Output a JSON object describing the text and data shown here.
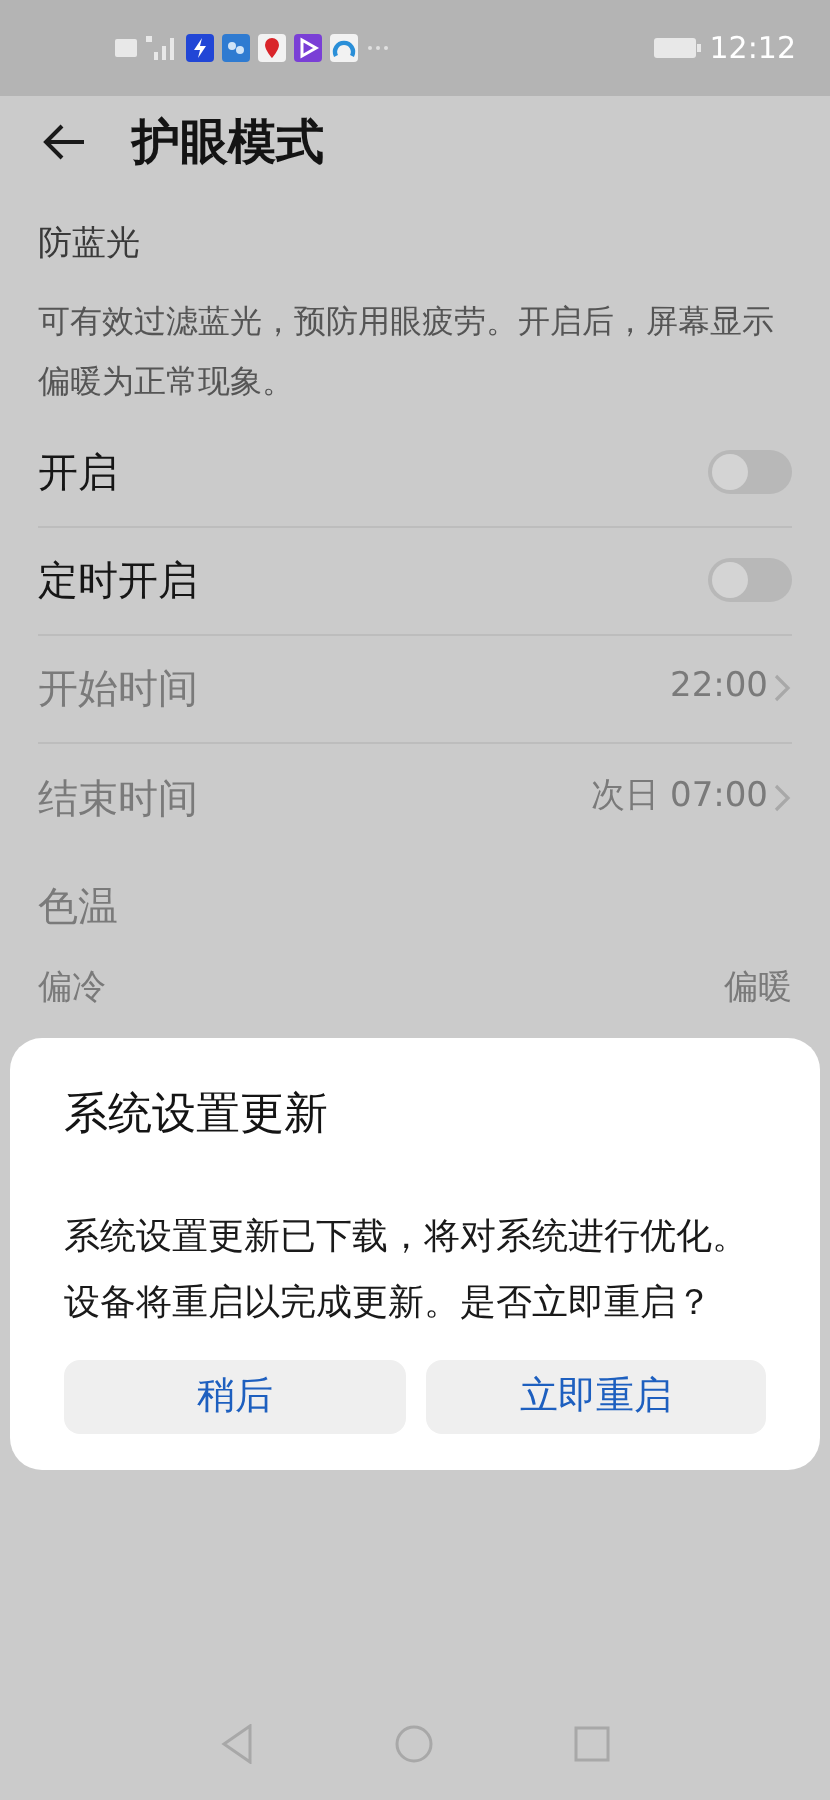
{
  "status_bar": {
    "time": "12:12"
  },
  "header": {
    "title": "护眼模式"
  },
  "section": {
    "title": "防蓝光",
    "description": "可有效过滤蓝光，预防用眼疲劳。开启后，屏幕显示偏暖为正常现象。"
  },
  "rows": [
    {
      "kind": "toggle",
      "label": "开启",
      "on": false,
      "disabled": false
    },
    {
      "kind": "toggle",
      "label": "定时开启",
      "on": false,
      "disabled": false
    },
    {
      "kind": "value",
      "label": "开始时间",
      "value": "22:00",
      "disabled": true
    },
    {
      "kind": "value",
      "label": "结束时间",
      "value": "次日 07:00",
      "disabled": true
    },
    {
      "kind": "label",
      "label": "色温",
      "disabled": true
    }
  ],
  "temperature": {
    "min_label": "偏冷",
    "max_label": "偏暖"
  },
  "dialog": {
    "title": "系统设置更新",
    "message": "系统设置更新已下载，将对系统进行优化。设备将重启以完成更新。是否立即重启？",
    "buttons": [
      "稍后",
      "立即重启"
    ]
  }
}
